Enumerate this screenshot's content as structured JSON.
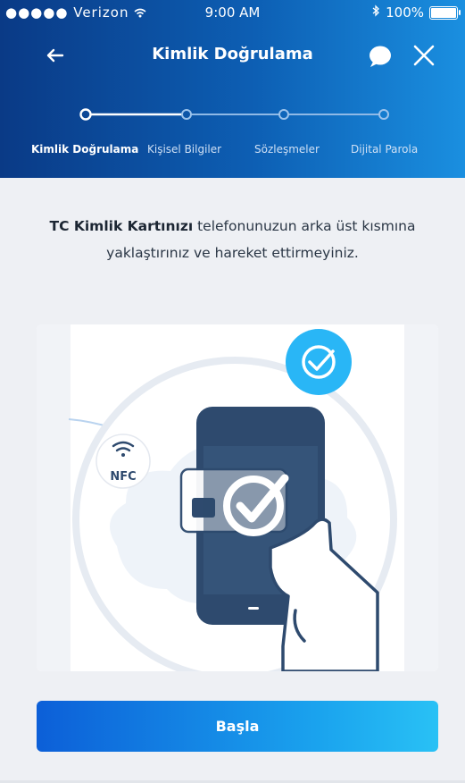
{
  "status_bar": {
    "signal": "●●●●●",
    "carrier": "Verizon",
    "time": "9:00 AM",
    "battery": "100%"
  },
  "nav": {
    "title": "Kimlik Doğrulama",
    "back_icon": "arrow-left-icon",
    "chat_icon": "chat-bubble-icon",
    "close_icon": "close-icon"
  },
  "steps": [
    {
      "label": "Kimlik Doğrulama",
      "active": true
    },
    {
      "label": "Kişisel Bilgiler",
      "active": false
    },
    {
      "label": "Sözleşmeler",
      "active": false
    },
    {
      "label": "Dijital Parola",
      "active": false
    }
  ],
  "instruction": {
    "bold": "TC Kimlik Kartınızı",
    "rest": " telefonunuzun arka üst kısmına yaklaştırınız ve hareket ettirmeyiniz."
  },
  "illustration": {
    "nfc_label": "NFC"
  },
  "start_button": "Başla",
  "colors": {
    "header_dark": "#0a3a86",
    "header_light": "#1a8fe0",
    "phone": "#2e4a6e",
    "accent": "#29b6f6"
  }
}
